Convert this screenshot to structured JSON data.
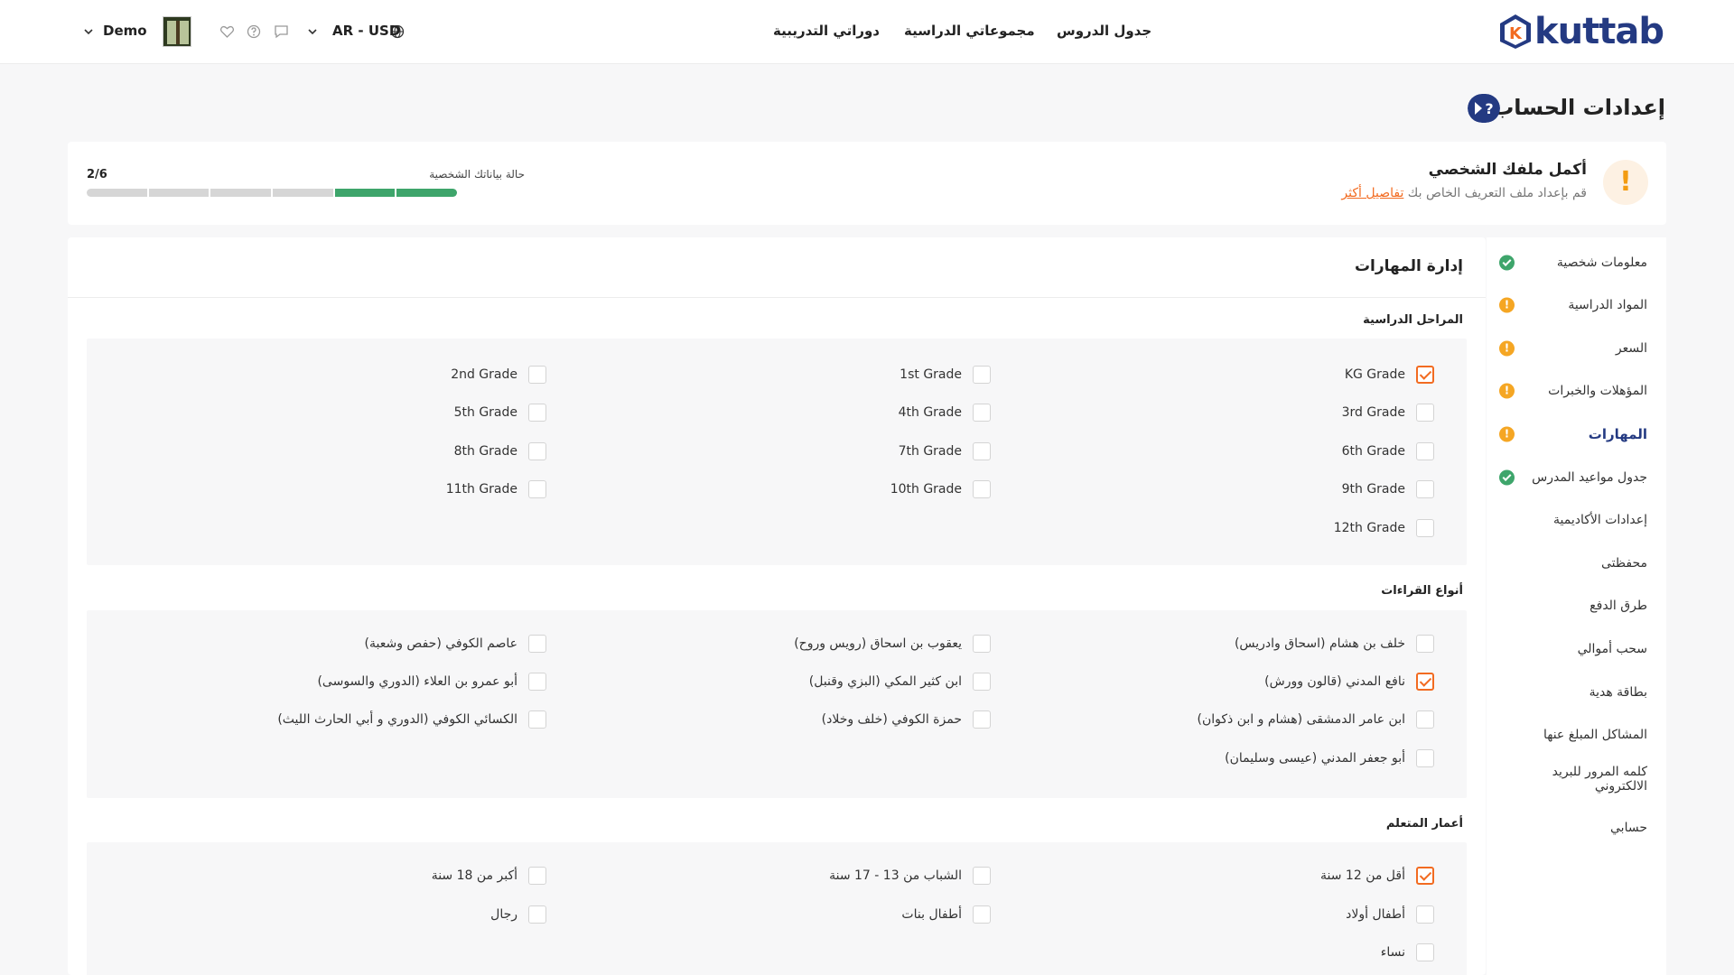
{
  "brand": {
    "name": "kuttab",
    "mark": "K"
  },
  "nav": {
    "schedule": "جدول الدروس",
    "groups": "مجموعاتي الدراسية",
    "courses": "دوراتي التدريبية"
  },
  "header": {
    "currency": "AR - USD",
    "user": "Demo"
  },
  "page": {
    "title": "إعدادات الحساب"
  },
  "profile": {
    "title": "أكمل ملفك الشخصي",
    "subtitle": "قم بإعداد ملف التعريف الخاص بك",
    "details_link": "تفاصيل أكثر",
    "status_label": "حالة بياناتك الشخصية",
    "count": "2/6",
    "progress_completed": 2,
    "progress_total": 6
  },
  "skills": {
    "title": "إدارة المهارات",
    "grades": {
      "title": "المراحل الدراسية",
      "options": [
        {
          "label": "KG Grade",
          "checked": true
        },
        {
          "label": "1st Grade",
          "checked": false
        },
        {
          "label": "2nd Grade",
          "checked": false
        },
        {
          "label": "3rd Grade",
          "checked": false
        },
        {
          "label": "4th Grade",
          "checked": false
        },
        {
          "label": "5th Grade",
          "checked": false
        },
        {
          "label": "6th Grade",
          "checked": false
        },
        {
          "label": "7th Grade",
          "checked": false
        },
        {
          "label": "8th Grade",
          "checked": false
        },
        {
          "label": "9th Grade",
          "checked": false
        },
        {
          "label": "10th Grade",
          "checked": false
        },
        {
          "label": "11th Grade",
          "checked": false
        },
        {
          "label": "12th Grade",
          "checked": false
        }
      ]
    },
    "readings": {
      "title": "أنواع القراءات",
      "options": [
        {
          "label": "خلف بن هشام (اسحاق وادريس)",
          "checked": false
        },
        {
          "label": "يعقوب بن اسحاق (رويس وروح)",
          "checked": false
        },
        {
          "label": "عاصم الكوفي (حفص وشعبة)",
          "checked": false
        },
        {
          "label": "نافع المدني (قالون وورش)",
          "checked": true
        },
        {
          "label": "ابن كثير المكي (البزي وقنبل)",
          "checked": false
        },
        {
          "label": "أبو عمرو بن العلاء (الدوري والسوسى)",
          "checked": false
        },
        {
          "label": "ابن عامر الدمشقى (هشام و ابن ذكوان)",
          "checked": false
        },
        {
          "label": "حمزة الكوفي (خلف وخلاد)",
          "checked": false
        },
        {
          "label": "الكسائي الكوفي (الدوري و أبي الحارث الليث)",
          "checked": false
        },
        {
          "label": "أبو جعفر المدني (عيسى وسليمان)",
          "checked": false
        }
      ]
    },
    "ages": {
      "title": "أعمار المتعلم",
      "options": [
        {
          "label": "أقل من 12 سنة",
          "checked": true
        },
        {
          "label": "الشباب من 13 - 17 سنة",
          "checked": false
        },
        {
          "label": "أكبر من 18 سنة",
          "checked": false
        },
        {
          "label": "أطفال أولاد",
          "checked": false
        },
        {
          "label": "أطفال بنات",
          "checked": false
        },
        {
          "label": "رجال",
          "checked": false
        },
        {
          "label": "نساء",
          "checked": false
        }
      ]
    }
  },
  "sidebar": {
    "items": [
      {
        "label": "معلومات شخصية",
        "status": "ok"
      },
      {
        "label": "المواد الدراسية",
        "status": "warn"
      },
      {
        "label": "السعر",
        "status": "warn"
      },
      {
        "label": "المؤهلات والخبرات",
        "status": "warn"
      },
      {
        "label": "المهارات",
        "status": "warn",
        "active": true
      },
      {
        "label": "جدول مواعيد المدرس",
        "status": "ok"
      },
      {
        "label": "إعدادات الأكاديمية",
        "status": "none"
      },
      {
        "label": "محفظتى",
        "status": "none"
      },
      {
        "label": "طرق الدفع",
        "status": "none"
      },
      {
        "label": "سحب أموالي",
        "status": "none"
      },
      {
        "label": "بطاقة هدية",
        "status": "none"
      },
      {
        "label": "المشاكل المبلغ عنها",
        "status": "none"
      },
      {
        "label": "كلمه المرور للبريد الالكتروني",
        "status": "none"
      },
      {
        "label": "حسابي",
        "status": "none"
      }
    ]
  }
}
